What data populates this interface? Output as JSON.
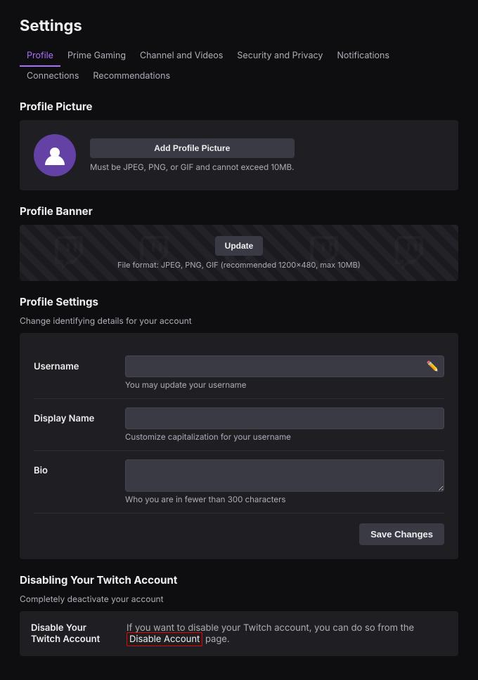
{
  "page": {
    "title": "Settings"
  },
  "nav": {
    "tabs": [
      {
        "id": "profile",
        "label": "Profile",
        "active": true
      },
      {
        "id": "prime-gaming",
        "label": "Prime Gaming",
        "active": false
      },
      {
        "id": "channel-and-videos",
        "label": "Channel and Videos",
        "active": false
      },
      {
        "id": "security-and-privacy",
        "label": "Security and Privacy",
        "active": false
      },
      {
        "id": "notifications",
        "label": "Notifications",
        "active": false
      },
      {
        "id": "connections",
        "label": "Connections",
        "active": false
      },
      {
        "id": "recommendations",
        "label": "Recommendations",
        "active": false
      }
    ]
  },
  "profile_picture": {
    "section_title": "Profile Picture",
    "add_button_label": "Add Profile Picture",
    "hint": "Must be JPEG, PNG, or GIF and cannot exceed 10MB."
  },
  "profile_banner": {
    "section_title": "Profile Banner",
    "update_button_label": "Update",
    "hint": "File format: JPEG, PNG, GIF (recommended 1200×480, max 10MB)"
  },
  "profile_settings": {
    "section_title": "Profile Settings",
    "section_subtitle": "Change identifying details for your account",
    "fields": {
      "username": {
        "label": "Username",
        "value": "",
        "hint": "You may update your username"
      },
      "display_name": {
        "label": "Display Name",
        "value": "",
        "hint": "Customize capitalization for your username"
      },
      "bio": {
        "label": "Bio",
        "value": "",
        "hint": "Who you are in fewer than 300 characters"
      }
    },
    "save_button_label": "Save Changes"
  },
  "disable_account": {
    "section_title": "Disabling Your Twitch Account",
    "section_subtitle": "Completely deactivate your account",
    "row_label": "Disable Your Twitch Account",
    "row_text_before": "If you want to disable your Twitch account, you can do so from the ",
    "row_link_text": "Disable Account",
    "row_text_after": " page."
  },
  "colors": {
    "accent_purple": "#a970ff",
    "link_red_border": "#eb0400",
    "bg_dark": "#0e0e10",
    "bg_card": "#1f1f23",
    "bg_input": "#3a3a45",
    "text_muted": "#adadb8",
    "text_primary": "#efeff1"
  }
}
